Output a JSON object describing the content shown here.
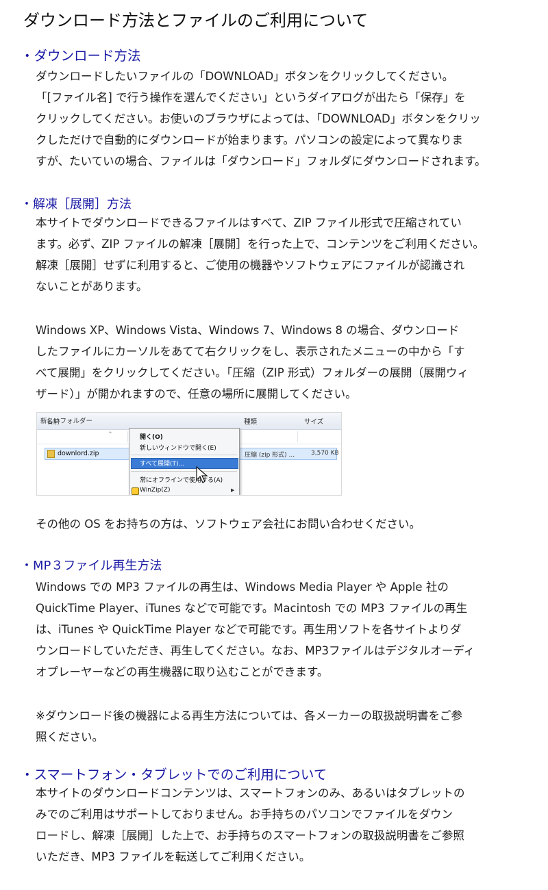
{
  "page": {
    "title": "ダウンロード方法とファイルのご利用について"
  },
  "sections": [
    {
      "heading": "・ダウンロード方法",
      "paragraphs": [
        [
          "ダウンロードしたいファイルの「DOWNLOAD」ボタンをクリックしてください。",
          "「[ファイル名] で行う操作を選んでください」というダイアログが出たら「保存」を",
          "クリックしてください。お使いのブラウザによっては、「DOWNLOAD」ボタンをクリッ",
          "クしただけで自動的にダウンロードが始まります。パソコンの設定によって異なりま",
          "すが、たいていの場合、ファイルは「ダウンロード」フォルダにダウンロードされます。"
        ]
      ]
    },
    {
      "heading": "・解凍［展開］方法",
      "paragraphs": [
        [
          "本サイトでダウンロードできるファイルはすべて、ZIP ファイル形式で圧縮されてい",
          "ます。必ず、ZIP ファイルの解凍［展開］を行った上で、コンテンツをご利用ください。",
          "解凍［展開］せずに利用すると、ご使用の機器やソフトウェアにファイルが認識され",
          "ないことがあります。"
        ],
        [
          "Windows XP、Windows Vista、Windows 7、Windows 8 の場合、ダウンロード",
          "したファイルにカーソルをあてて右クリックをし、表示されたメニューの中から「す",
          "べて展開」をクリックしてください。「圧縮（ZIP 形式）フォルダーの展開（展開ウィ",
          "ザード）」が開かれますので、任意の場所に展開してください。"
        ],
        [
          "その他の OS をお持ちの方は、ソフトウェア会社にお問い合わせください。"
        ]
      ],
      "figure": {
        "window_title": "新しいフォルダー",
        "columns": [
          "名前",
          "種類",
          "サイズ"
        ],
        "file": {
          "name": "downlord.zip",
          "type": "圧縮 (zip 形式) ...",
          "size": "3,570 KB"
        },
        "menu": [
          "開く(O)",
          "新しいウィンドウで開く(E)",
          "すべて展開(T)...",
          "常にオフラインで使用する(A)",
          "WinZip(Z)"
        ]
      }
    },
    {
      "heading": "・MP３ファイル再生方法",
      "paragraphs": [
        [
          "Windows での MP3 ファイルの再生は、Windows Media Player や Apple 社の",
          "QuickTime Player、iTunes などで可能です。Macintosh での MP3 ファイルの再生",
          "は、iTunes や QuickTime Player などで可能です。再生用ソフトを各サイトよりダ",
          "ウンロードしていただき、再生してください。なお、MP3ファイルはデジタルオーディ",
          "オプレーヤーなどの再生機器に取り込むことができます。"
        ],
        [
          "※ダウンロード後の機器による再生方法については、各メーカーの取扱説明書をご参",
          "照ください。"
        ]
      ]
    },
    {
      "heading": "・スマートフォン・タブレットでのご利用について",
      "paragraphs": [
        [
          "本サイトのダウンロードコンテンツは、スマートフォンのみ、あるいはタブレットの",
          "みでのご利用はサポートしておりません。お手持ちのパソコンでファイルをダウン",
          "ロードし、解凍［展開］した上で、お手持ちのスマートフォンの取扱説明書をご参照",
          "いただき、MP3 ファイルを転送してご利用ください。"
        ]
      ]
    }
  ],
  "colors": {
    "heading": "#1a1aa6",
    "body_text": "#222222",
    "menu_highlight": "#3a7bd5"
  },
  "icons": {
    "zip_file": "zip-file-icon",
    "winzip": "winzip-icon",
    "cursor": "mouse-cursor-icon"
  }
}
